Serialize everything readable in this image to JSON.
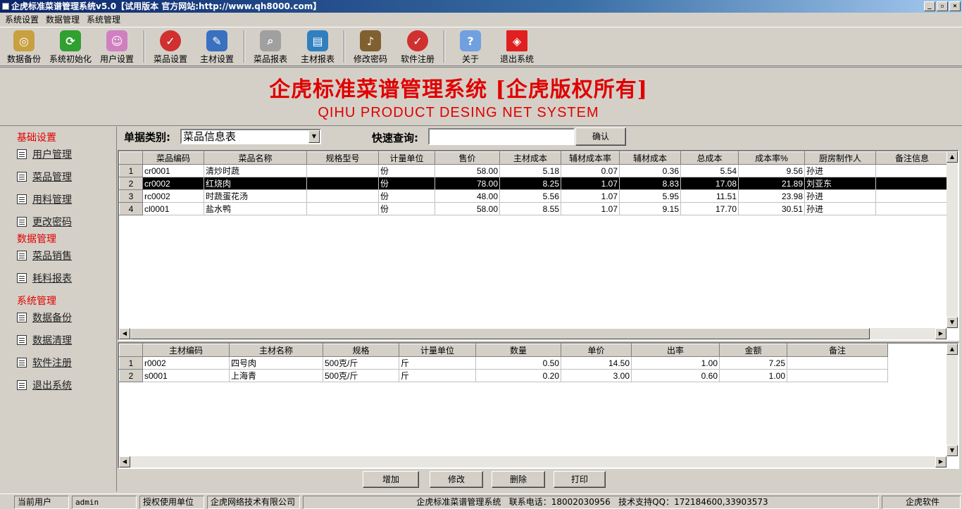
{
  "window": {
    "title": "企虎标准菜谱管理系统v5.0【试用版本 官方网站:http://www.qh8000.com】"
  },
  "menu": [
    "系统设置",
    "数据管理",
    "系统管理"
  ],
  "toolbar": [
    {
      "label": "数据备份",
      "icon": "database-backup-icon",
      "color": "#c8a040"
    },
    {
      "label": "系统初始化",
      "icon": "refresh-icon",
      "color": "#30a030"
    },
    {
      "label": "用户设置",
      "icon": "user-settings-icon",
      "color": "#d080c0"
    },
    {
      "label": "菜品设置",
      "icon": "check-badge-icon",
      "color": "#d03030"
    },
    {
      "label": "主材设置",
      "icon": "document-edit-icon",
      "color": "#3a70c0"
    },
    {
      "label": "菜品报表",
      "icon": "search-icon",
      "color": "#808080"
    },
    {
      "label": "主材报表",
      "icon": "report-icon",
      "color": "#3080c0"
    },
    {
      "label": "修改密码",
      "icon": "key-icon",
      "color": "#806030"
    },
    {
      "label": "软件注册",
      "icon": "check-badge-icon",
      "color": "#d03030"
    },
    {
      "label": "关于",
      "icon": "help-person-icon",
      "color": "#70a0e0"
    },
    {
      "label": "退出系统",
      "icon": "exit-cube-icon",
      "color": "#e02020"
    }
  ],
  "banner": {
    "title": "企虎标准菜谱管理系统 [企虎版权所有]",
    "subtitle": "QIHU PRODUCT DESING NET SYSTEM"
  },
  "sidebar": {
    "groups": [
      {
        "title": "基础设置",
        "items": [
          "用户管理",
          "菜品管理",
          "用料管理",
          "更改密码"
        ]
      },
      {
        "title": "数据管理",
        "items": [
          "菜品销售",
          "耗料报表"
        ]
      },
      {
        "title": "系统管理",
        "items": [
          "数据备份",
          "数据清理",
          "软件注册",
          "退出系统"
        ]
      }
    ]
  },
  "query": {
    "category_label": "单据类别:",
    "category_value": "菜品信息表",
    "search_label": "快速查询:",
    "search_value": "",
    "confirm": "确认"
  },
  "dish_table": {
    "columns": [
      "菜品编码",
      "菜品名称",
      "规格型号",
      "计量单位",
      "售价",
      "主材成本",
      "辅材成本率",
      "辅材成本",
      "总成本",
      "成本率%",
      "厨房制作人",
      "备注信息"
    ],
    "rows": [
      [
        "cr0001",
        "清炒时蔬",
        "",
        "份",
        "58.00",
        "5.18",
        "0.07",
        "0.36",
        "5.54",
        "9.56",
        "孙进",
        ""
      ],
      [
        "cr0002",
        "红烧肉",
        "",
        "份",
        "78.00",
        "8.25",
        "1.07",
        "8.83",
        "17.08",
        "21.89",
        "刘亚东",
        ""
      ],
      [
        "rc0002",
        "时蔬蛋花汤",
        "",
        "份",
        "48.00",
        "5.56",
        "1.07",
        "5.95",
        "11.51",
        "23.98",
        "孙进",
        ""
      ],
      [
        "cl0001",
        "盐水鸭",
        "",
        "份",
        "58.00",
        "8.55",
        "1.07",
        "9.15",
        "17.70",
        "30.51",
        "孙进",
        ""
      ]
    ],
    "selected_row": 2
  },
  "material_table": {
    "columns": [
      "主材编码",
      "主材名称",
      "规格",
      "计量单位",
      "数量",
      "单价",
      "出率",
      "金额",
      "备注"
    ],
    "rows": [
      [
        "r0002",
        "四号肉",
        "500克/斤",
        "斤",
        "0.50",
        "14.50",
        "1.00",
        "7.25",
        ""
      ],
      [
        "s0001",
        "上海青",
        "500克/斤",
        "斤",
        "0.20",
        "3.00",
        "0.60",
        "1.00",
        ""
      ]
    ]
  },
  "actions": [
    "增加",
    "修改",
    "删除",
    "打印"
  ],
  "status": {
    "user_label": "当前用户",
    "user": "admin",
    "licensee_label": "授权使用单位",
    "licensee": "企虎网络技术有限公司",
    "info": "企虎标准菜谱管理系统   联系电话：18002030956   技术支持QQ：172184600,33903573",
    "brand": "企虎软件"
  }
}
